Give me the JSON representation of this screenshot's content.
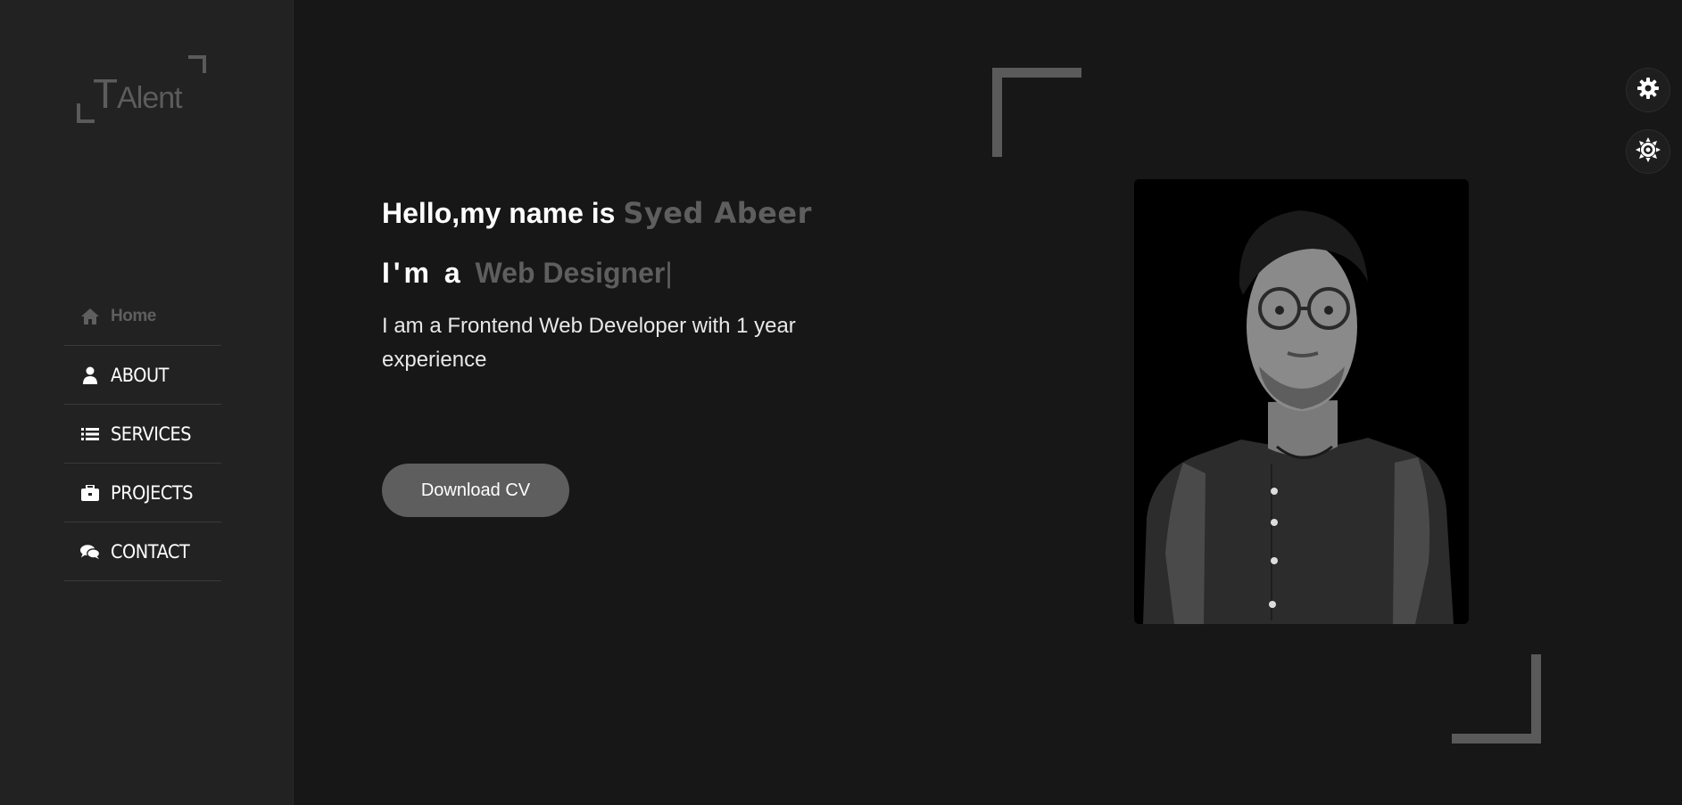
{
  "logo": {
    "text_big": "T",
    "text_rest": "Alent"
  },
  "nav": {
    "items": [
      {
        "label": "Home",
        "icon": "home-icon",
        "active": true
      },
      {
        "label": "ABOUT",
        "icon": "user-icon",
        "active": false
      },
      {
        "label": "SERVICES",
        "icon": "list-icon",
        "active": false
      },
      {
        "label": "PROJECTS",
        "icon": "briefcase-icon",
        "active": false
      },
      {
        "label": "CONTACT",
        "icon": "comments-icon",
        "active": false
      }
    ]
  },
  "hero": {
    "greeting": "Hello,my name is ",
    "name": "Syed Abeer",
    "role_prefix": "I'm a ",
    "role_typed": "Web Designer",
    "caret": "|",
    "description": "I am a Frontend Web Developer with 1 year experience",
    "cta_label": "Download CV"
  },
  "floating": {
    "settings_icon": "gear-icon",
    "theme_icon": "sun-gear-icon"
  },
  "colors": {
    "background": "#171717",
    "sidebar": "#222222",
    "accent": "#5e5e5e",
    "text": "#ffffff"
  }
}
